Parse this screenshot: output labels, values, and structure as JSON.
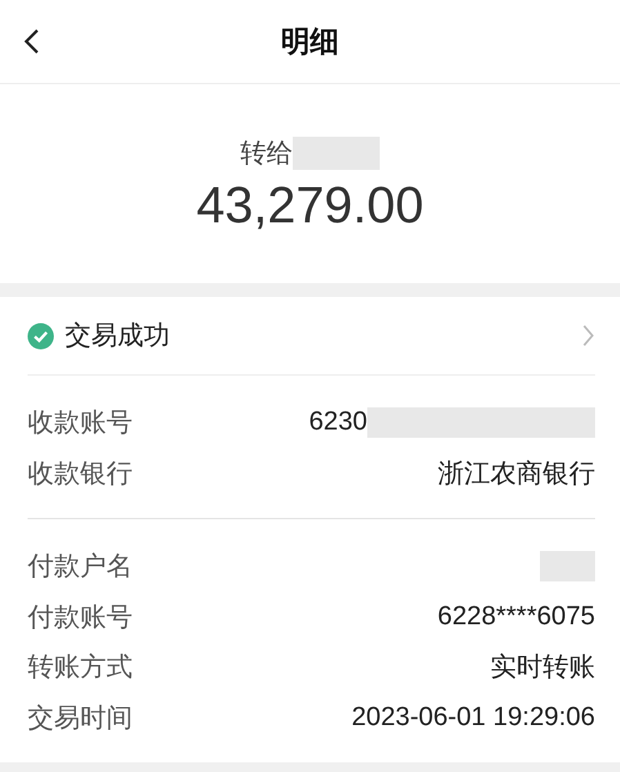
{
  "header": {
    "title": "明细"
  },
  "summary": {
    "recipient_label": "转给",
    "recipient_redacted": true,
    "amount": "43,279.00"
  },
  "status": {
    "text": "交易成功",
    "success": true
  },
  "groups": [
    {
      "rows": [
        {
          "label": "收款账号",
          "value": "6230",
          "redacted": true
        },
        {
          "label": "收款银行",
          "value": "浙江农商银行"
        }
      ]
    },
    {
      "rows": [
        {
          "label": "付款户名",
          "redacted": true
        },
        {
          "label": "付款账号",
          "value": "6228****6075"
        },
        {
          "label": "转账方式",
          "value": "实时转账"
        },
        {
          "label": "交易时间",
          "value": "2023-06-01 19:29:06"
        }
      ]
    }
  ]
}
